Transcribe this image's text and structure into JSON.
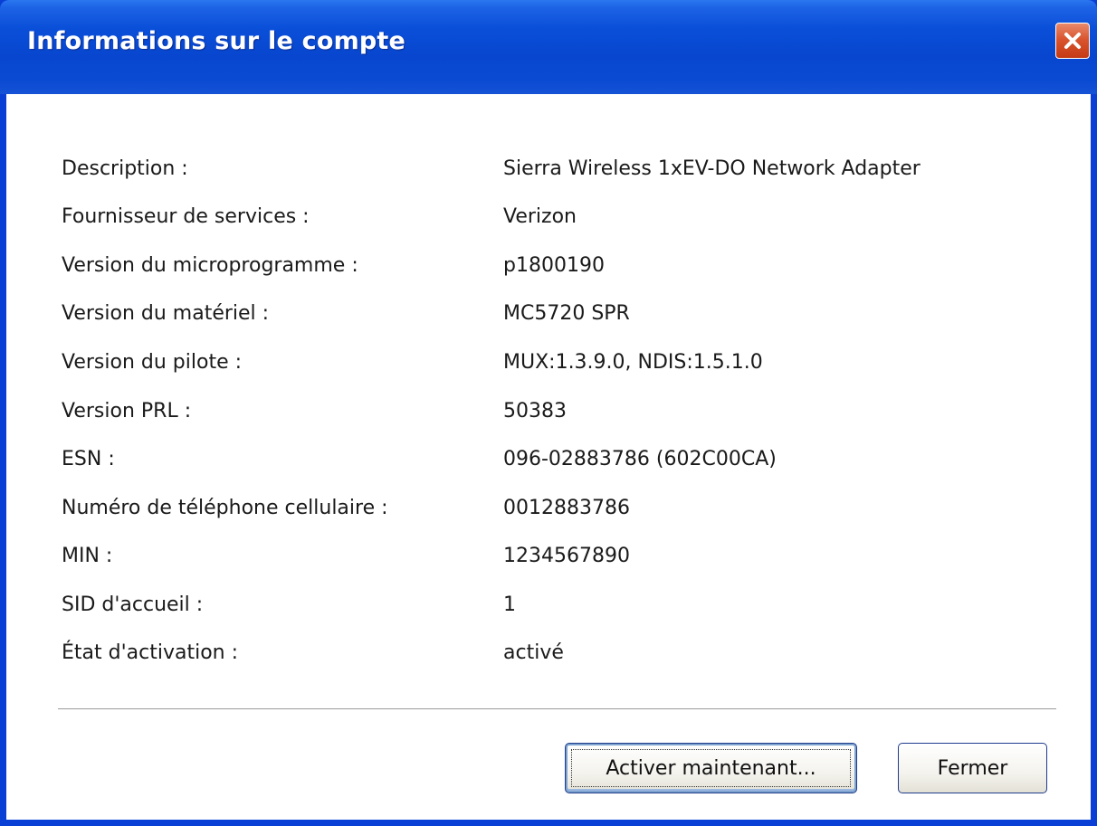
{
  "window": {
    "title": "Informations sur le compte"
  },
  "fields": [
    {
      "label": "Description :",
      "value": "Sierra Wireless 1xEV-DO Network Adapter"
    },
    {
      "label": "Fournisseur de services :",
      "value": "Verizon"
    },
    {
      "label": "Version du microprogramme :",
      "value": "p1800190"
    },
    {
      "label": "Version du matériel :",
      "value": "MC5720 SPR"
    },
    {
      "label": "Version du pilote :",
      "value": "MUX:1.3.9.0, NDIS:1.5.1.0"
    },
    {
      "label": "Version PRL :",
      "value": "50383"
    },
    {
      "label": "ESN :",
      "value": "096-02883786 (602C00CA)"
    },
    {
      "label": "Numéro de téléphone cellulaire :",
      "value": "0012883786"
    },
    {
      "label": "MIN :",
      "value": "1234567890"
    },
    {
      "label": "SID d'accueil :",
      "value": "1"
    },
    {
      "label": "État d'activation :",
      "value": "activé"
    }
  ],
  "buttons": {
    "activate": "Activer maintenant...",
    "close": "Fermer"
  },
  "icons": {
    "close": "close-x-icon"
  },
  "colors": {
    "titlebar": "#0a4fd8",
    "close_button": "#d9552f",
    "window_frame": "#0a3fd6"
  }
}
